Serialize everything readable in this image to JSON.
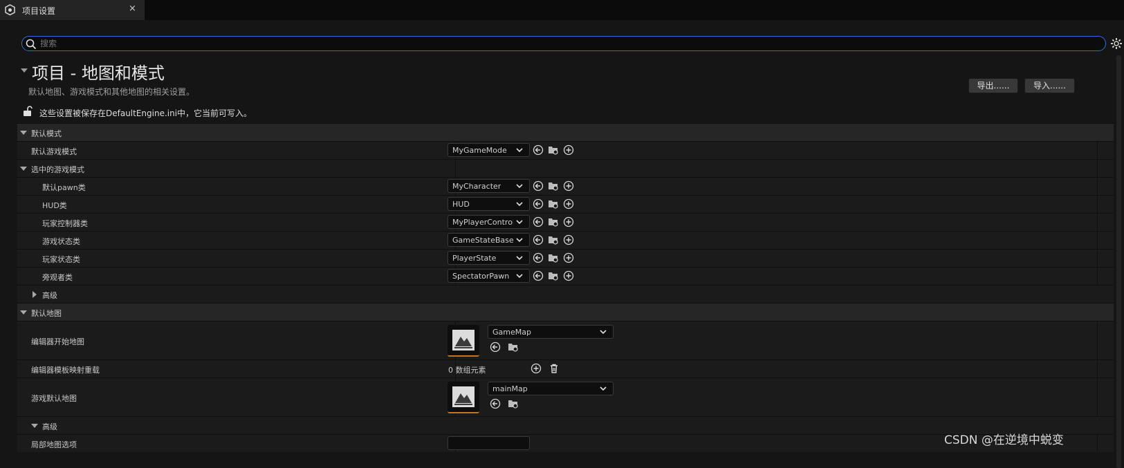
{
  "tab": {
    "title": "项目设置",
    "close": "×"
  },
  "search": {
    "placeholder": "搜索",
    "value": ""
  },
  "header": {
    "title": "项目 - 地图和模式",
    "description": "默认地图、游戏模式和其他地图的相关设置。",
    "config_note": "这些设置被保存在DefaultEngine.ini中，它当前可写入。",
    "export_label": "导出......",
    "import_label": "导入......"
  },
  "sections": {
    "default_modes": {
      "label": "默认模式"
    },
    "default_game_mode": {
      "label": "默认游戏模式",
      "value": "MyGameMode"
    },
    "selected_game_mode": {
      "label": "选中的游戏模式"
    },
    "pawn": {
      "label": "默认pawn类",
      "value": "MyCharacter"
    },
    "hud": {
      "label": "HUD类",
      "value": "HUD"
    },
    "player_controller": {
      "label": "玩家控制器类",
      "value": "MyPlayerControlle"
    },
    "game_state": {
      "label": "游戏状态类",
      "value": "GameStateBase"
    },
    "player_state": {
      "label": "玩家状态类",
      "value": "PlayerState"
    },
    "spectator": {
      "label": "旁观者类",
      "value": "SpectatorPawn"
    },
    "advanced1": {
      "label": "高级"
    },
    "default_maps": {
      "label": "默认地图"
    },
    "editor_startup_map": {
      "label": "编辑器开始地图",
      "value": "GameMap"
    },
    "editor_template_override": {
      "label": "编辑器模板映射重载",
      "value": "0 数组元素"
    },
    "game_default_map": {
      "label": "游戏默认地图",
      "value": "mainMap"
    },
    "advanced2": {
      "label": "高级"
    },
    "local_map_options": {
      "label": "局部地图选项",
      "value": ""
    }
  },
  "watermark": "CSDN @在逆境中蜕变",
  "colors": {
    "accent": "#2f6fd6",
    "thumb_underline": "#c77423"
  }
}
